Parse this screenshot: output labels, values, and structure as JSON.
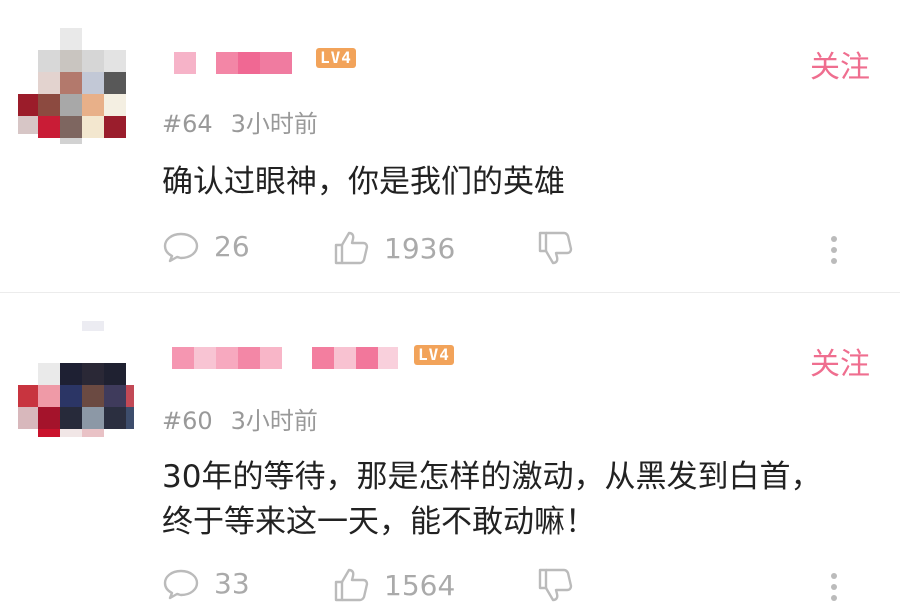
{
  "comments": [
    {
      "level": "LV4",
      "follow_label": "关注",
      "floor": "#64",
      "time": "3小时前",
      "text": "确认过眼神，你是我们的英雄",
      "reply_count": "26",
      "like_count": "1936"
    },
    {
      "level": "LV4",
      "follow_label": "关注",
      "floor": "#60",
      "time": "3小时前",
      "text": "30年的等待，那是怎样的激动，从黑发到白首，终于等来这一天，能不敢动嘛！",
      "reply_count": "33",
      "like_count": "1564"
    }
  ],
  "colors": {
    "accent": "#ef6e8f",
    "level_badge": "#f2a35a",
    "muted_text": "#999999"
  },
  "icons": [
    "comment-icon",
    "thumbs-up-icon",
    "thumbs-down-icon",
    "more-vertical-icon"
  ]
}
